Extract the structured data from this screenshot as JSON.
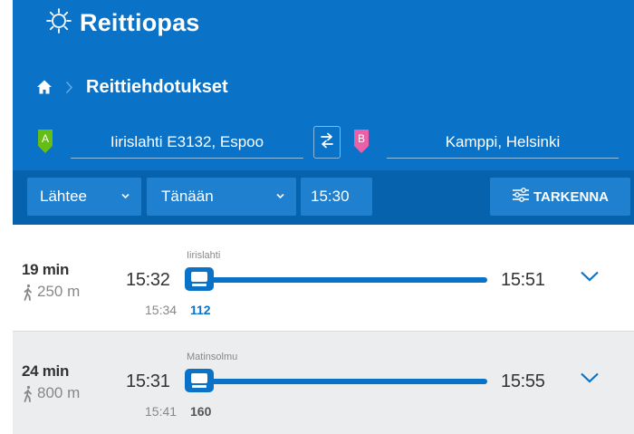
{
  "app": {
    "name": "Reittiopas",
    "logo_icon": "sun-icon"
  },
  "breadcrumb": {
    "home_icon": "home-icon",
    "title": "Reittiehdotukset"
  },
  "search": {
    "origin_marker": "A",
    "origin": "Iirislahti E3132, Espoo",
    "destination_marker": "B",
    "destination": "Kamppi, Helsinki"
  },
  "filters": {
    "departure_mode": "Lähtee",
    "day": "Tänään",
    "time": "15:30",
    "refine_label": "TARKENNA"
  },
  "routes": [
    {
      "duration": "19 min",
      "walk_distance": "250 m",
      "departure": "15:32",
      "arrival": "15:51",
      "stop_name": "Iirislahti",
      "scheduled_time": "15:34",
      "bus_number": "112"
    },
    {
      "duration": "24 min",
      "walk_distance": "800 m",
      "departure": "15:31",
      "arrival": "15:55",
      "stop_name": "Matinsolmu",
      "scheduled_time": "15:41",
      "bus_number": "160"
    }
  ],
  "colors": {
    "brand_blue": "#0a73c8",
    "filter_bar": "#0762ad",
    "origin_marker": "#64be14",
    "destination_marker": "#ec5fa9"
  }
}
